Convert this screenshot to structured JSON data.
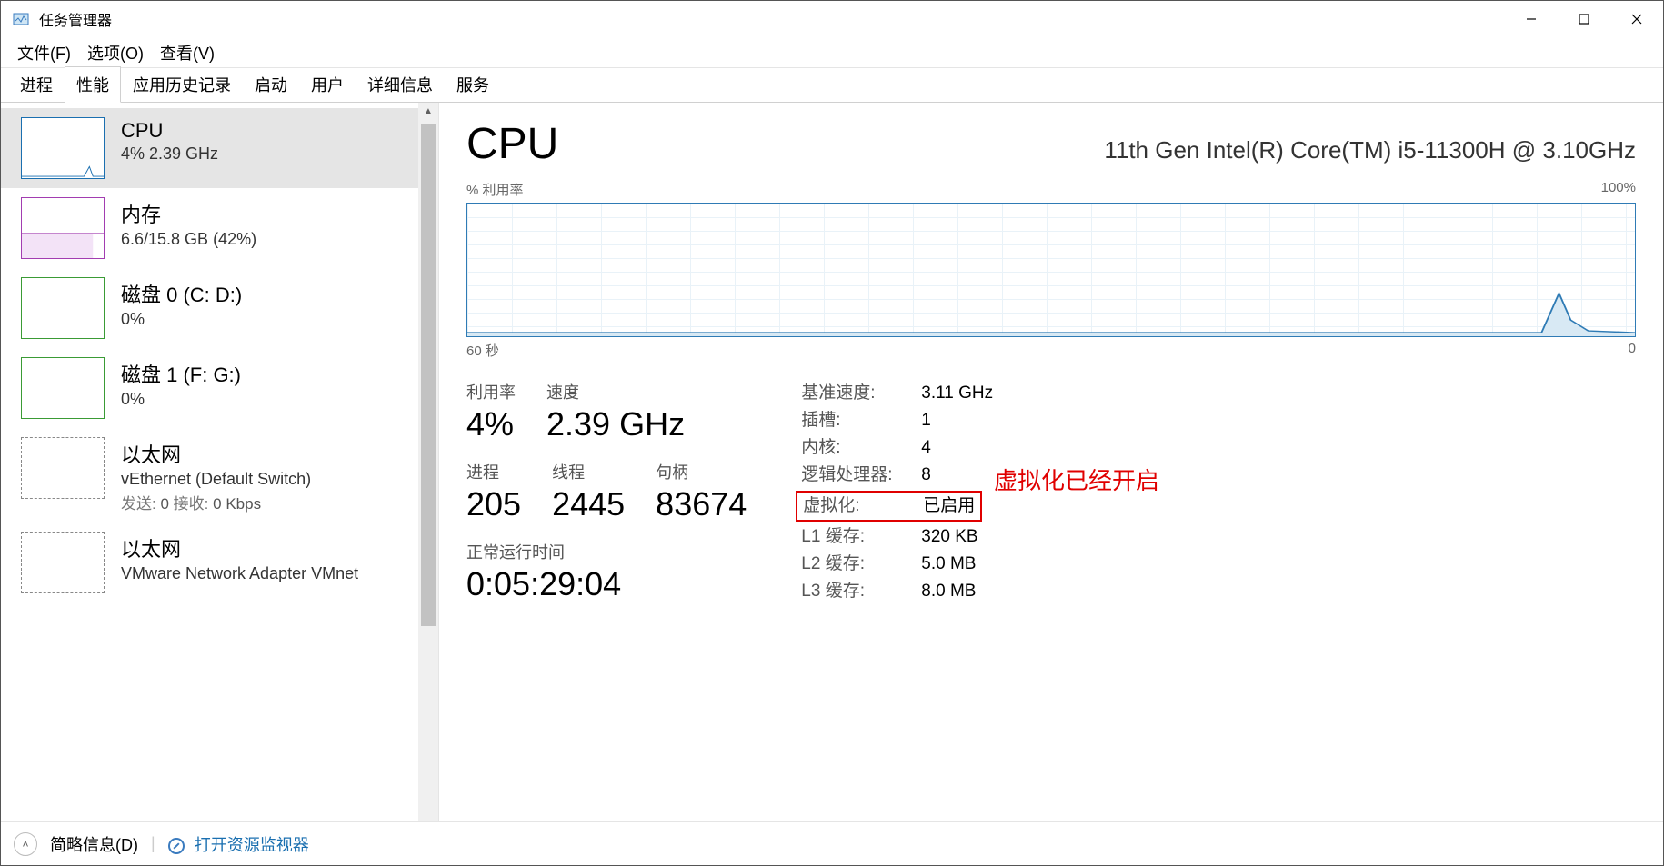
{
  "window": {
    "title": "任务管理器"
  },
  "menu": {
    "file": "文件(F)",
    "options": "选项(O)",
    "view": "查看(V)"
  },
  "tabs": [
    "进程",
    "性能",
    "应用历史记录",
    "启动",
    "用户",
    "详细信息",
    "服务"
  ],
  "active_tab_index": 1,
  "sidebar": {
    "items": [
      {
        "kind": "cpu",
        "title": "CPU",
        "sub": "4%  2.39 GHz"
      },
      {
        "kind": "mem",
        "title": "内存",
        "sub": "6.6/15.8 GB (42%)"
      },
      {
        "kind": "disk",
        "title": "磁盘 0 (C: D:)",
        "sub": "0%"
      },
      {
        "kind": "disk",
        "title": "磁盘 1 (F: G:)",
        "sub": "0%"
      },
      {
        "kind": "eth",
        "title": "以太网",
        "sub": "vEthernet (Default Switch)",
        "send_label": "发送:",
        "send_value": "0",
        "recv_label": "接收:",
        "recv_value": "0 Kbps"
      },
      {
        "kind": "eth",
        "title": "以太网",
        "sub": "VMware Network Adapter VMnet"
      }
    ],
    "selected_index": 0
  },
  "main": {
    "title": "CPU",
    "model": "11th Gen Intel(R) Core(TM) i5-11300H @ 3.10GHz",
    "chart_top_left": "% 利用率",
    "chart_top_right": "100%",
    "chart_bottom_left": "60 秒",
    "chart_bottom_right": "0",
    "stats": {
      "util_label": "利用率",
      "util_value": "4%",
      "speed_label": "速度",
      "speed_value": "2.39 GHz",
      "proc_label": "进程",
      "proc_value": "205",
      "thread_label": "线程",
      "thread_value": "2445",
      "handle_label": "句柄",
      "handle_value": "83674",
      "uptime_label": "正常运行时间",
      "uptime_value": "0:05:29:04"
    },
    "specs": {
      "base_label": "基准速度:",
      "base_value": "3.11 GHz",
      "sockets_label": "插槽:",
      "sockets_value": "1",
      "cores_label": "内核:",
      "cores_value": "4",
      "logical_label": "逻辑处理器:",
      "logical_value": "8",
      "virt_label": "虚拟化:",
      "virt_value": "已启用",
      "l1_label": "L1 缓存:",
      "l1_value": "320 KB",
      "l2_label": "L2 缓存:",
      "l2_value": "5.0 MB",
      "l3_label": "L3 缓存:",
      "l3_value": "8.0 MB"
    },
    "annotation": "虚拟化已经开启"
  },
  "footer": {
    "less": "简略信息(D)",
    "resmon": "打开资源监视器"
  },
  "chart_data": {
    "type": "line",
    "title": "% 利用率",
    "ylabel": "% 利用率",
    "xlabel": "秒",
    "xlim": [
      60,
      0
    ],
    "ylim": [
      0,
      100
    ],
    "x": [
      60,
      57,
      54,
      51,
      48,
      45,
      42,
      39,
      36,
      33,
      30,
      27,
      24,
      21,
      18,
      15,
      12,
      9,
      6,
      5,
      4,
      3,
      2,
      1,
      0
    ],
    "values": [
      3,
      3,
      3,
      3,
      3,
      3,
      3,
      3,
      3,
      3,
      3,
      3,
      3,
      3,
      3,
      3,
      3,
      3,
      4,
      15,
      30,
      12,
      6,
      4,
      4
    ]
  }
}
